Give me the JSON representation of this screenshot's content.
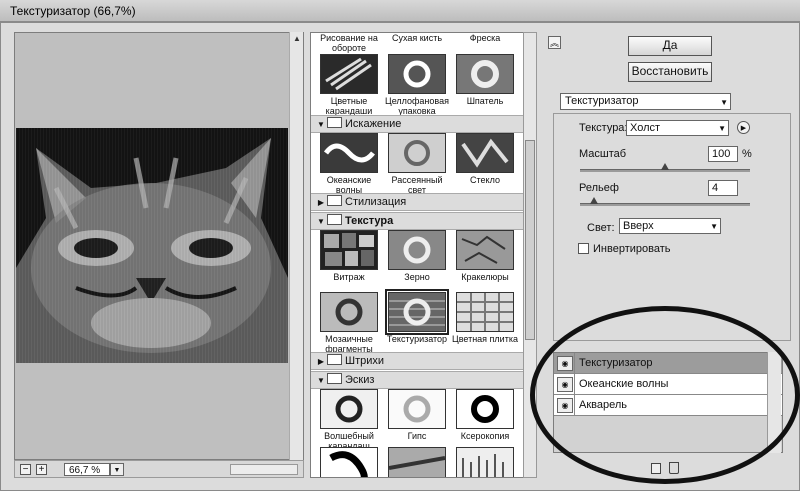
{
  "window": {
    "title": "Текстуризатор (66,7%)"
  },
  "preview": {
    "zoom": "66,7 %",
    "zoom_out": "−",
    "zoom_in": "+"
  },
  "gallery": {
    "top_row": [
      "Рисование на обороте",
      "Сухая кисть",
      "Фреска"
    ],
    "artistic_row": [
      "Цветные карандаши",
      "Целлофановая упаковка",
      "Шпатель"
    ],
    "categories": {
      "distort": "Искажение",
      "stylize": "Стилизация",
      "texture": "Текстура",
      "strokes": "Штрихи",
      "sketch": "Эскиз"
    },
    "distort_items": [
      "Океанские волны",
      "Рассеянный свет",
      "Стекло"
    ],
    "texture_items_1": [
      "Витраж",
      "Зерно",
      "Кракелюры"
    ],
    "texture_items_2": [
      "Мозаичные фрагменты",
      "Текстуризатор",
      "Цветная плитка"
    ],
    "sketch_items": [
      "Волшебный карандаш",
      "Гипс",
      "Ксерокопия"
    ],
    "selected": "Текстуризатор"
  },
  "buttons": {
    "ok": "Да",
    "reset": "Восстановить"
  },
  "settings": {
    "filter": "Текстуризатор",
    "texture_label": "Текстура:",
    "texture_value": "Холст",
    "scale_label": "Масштаб",
    "scale_value": "100",
    "scale_unit": "%",
    "scale_level": 0.5,
    "relief_label": "Рельеф",
    "relief_value": "4",
    "relief_level": 0.08,
    "light_label": "Свет:",
    "light_value": "Вверх",
    "invert_label": "Инвертировать",
    "invert_checked": false
  },
  "layers": [
    "Текстуризатор",
    "Океанские волны",
    "Акварель"
  ],
  "icons": {
    "eye": "eye-icon",
    "new_layer": "new-layer-icon",
    "delete": "trash-icon",
    "collapse": "double-chevron-up-icon"
  }
}
